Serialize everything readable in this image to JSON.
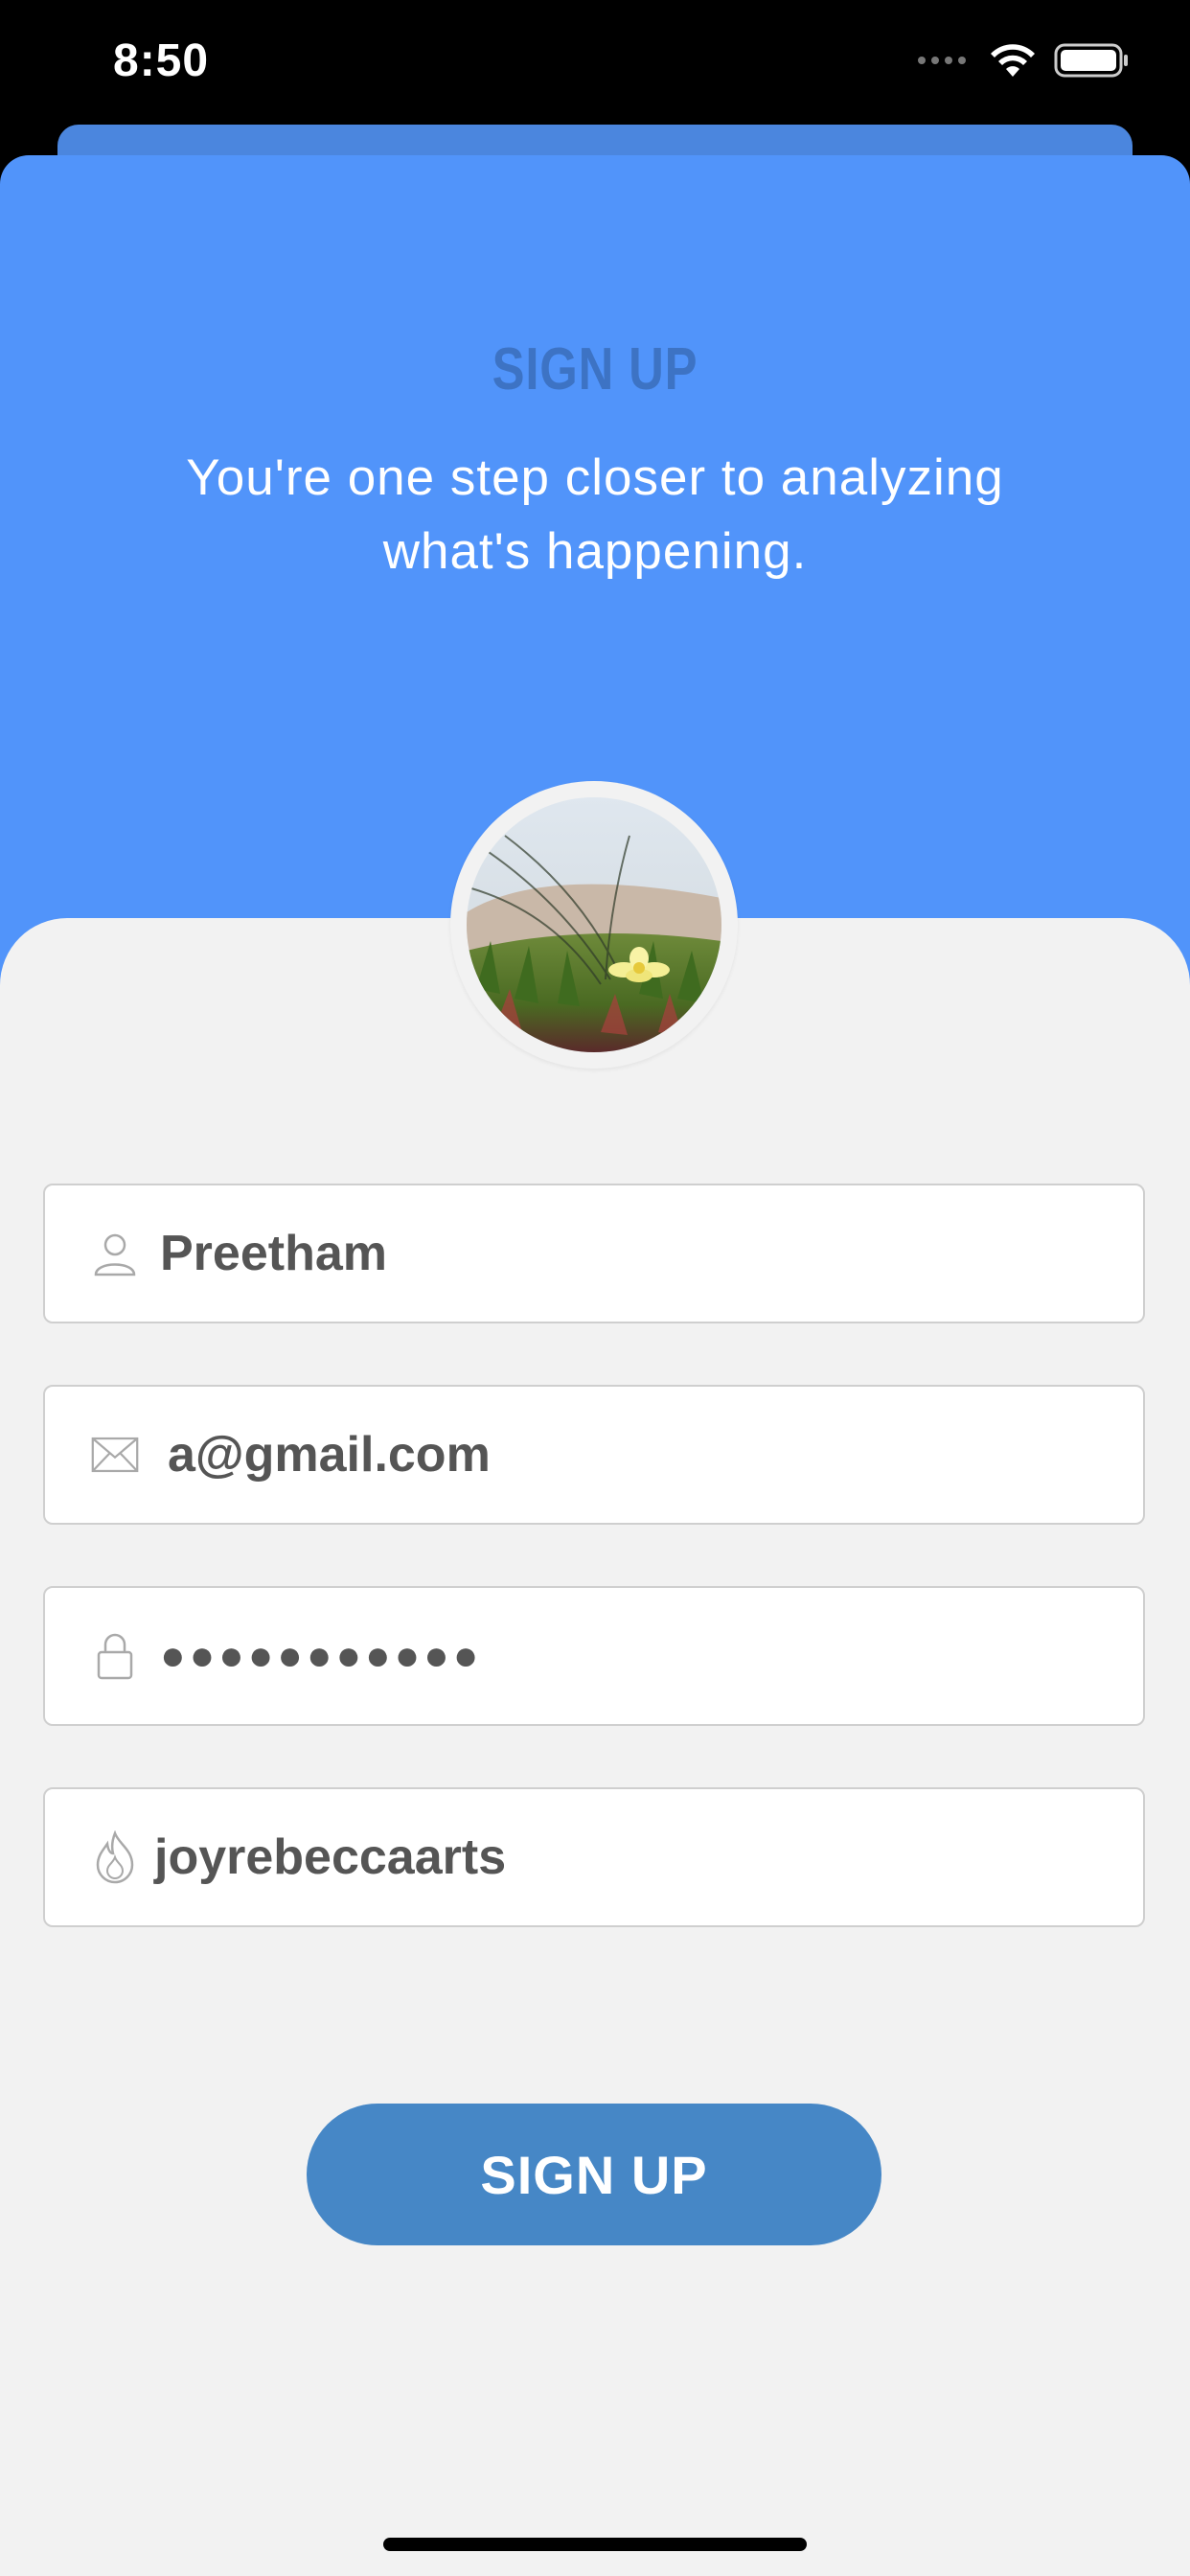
{
  "status_bar": {
    "time": "8:50"
  },
  "header": {
    "title": "SIGN UP",
    "subtitle": "You're one step closer to analyzing what's happening."
  },
  "form": {
    "fields": [
      {
        "name": "username",
        "icon": "user-icon",
        "value": "Preetham"
      },
      {
        "name": "email",
        "icon": "envelope-icon",
        "value": "a@gmail.com"
      },
      {
        "name": "password",
        "icon": "lock-icon",
        "value": "●●●●●●●●●●●"
      },
      {
        "name": "handle",
        "icon": "flame-icon",
        "value": "joyrebeccaarts"
      }
    ],
    "submit_label": "SIGN UP"
  },
  "colors": {
    "header_blue": "#5194fa",
    "title_blue": "#3d73c4",
    "button_blue": "#4687c6",
    "panel_gray": "#f2f2f2"
  }
}
